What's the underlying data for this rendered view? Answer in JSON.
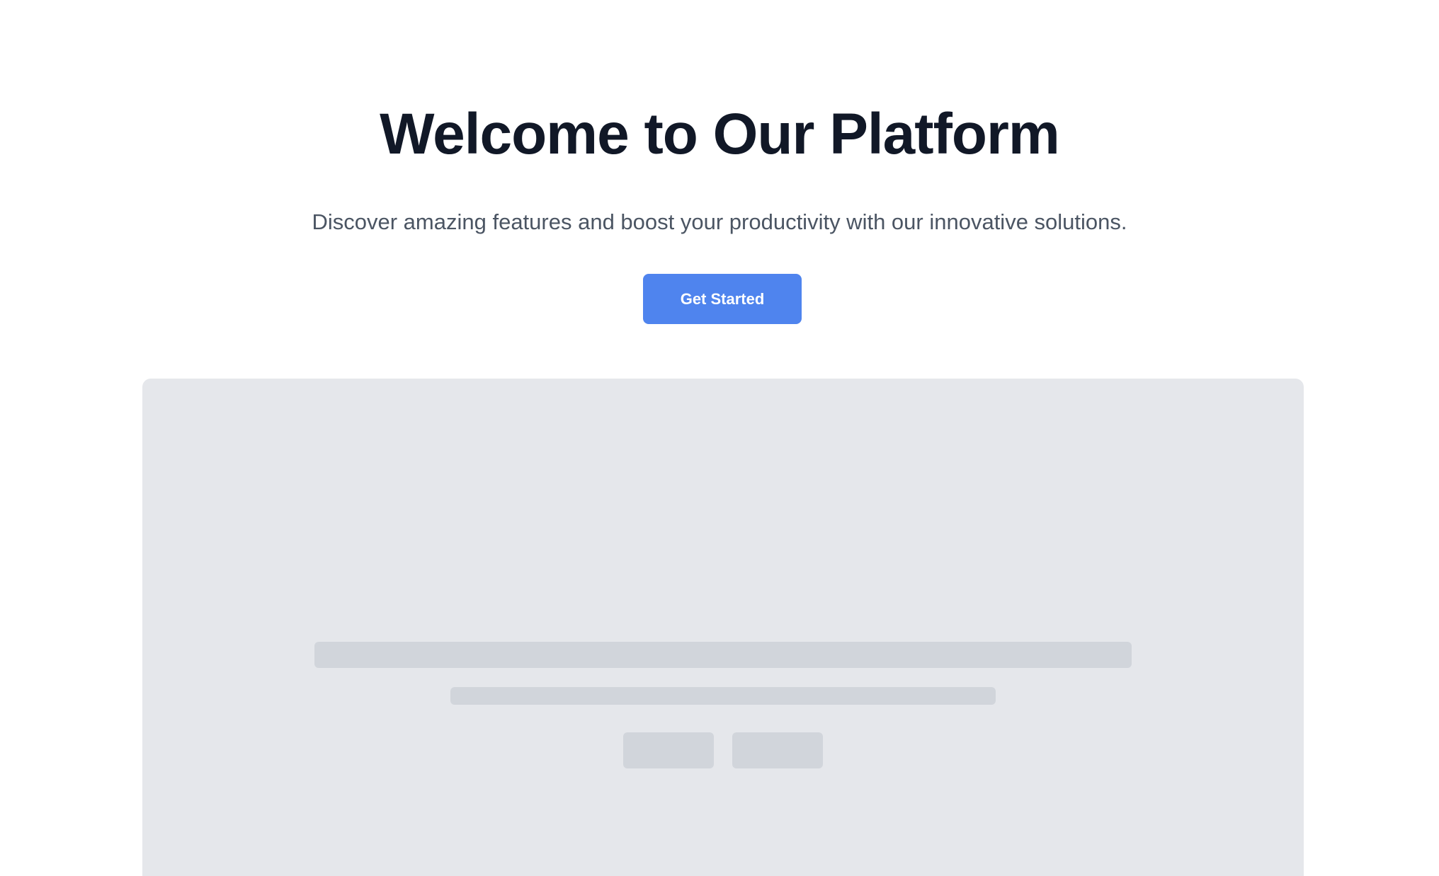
{
  "hero": {
    "title": "Welcome to Our Platform",
    "subtitle": "Discover amazing features and boost your productivity with our innovative solutions.",
    "cta_label": "Get Started"
  },
  "colors": {
    "accent": "#4f84ee",
    "title": "#111827",
    "subtitle": "#4b5563",
    "panel": "#e5e7eb",
    "skeleton": "#d1d5db"
  }
}
